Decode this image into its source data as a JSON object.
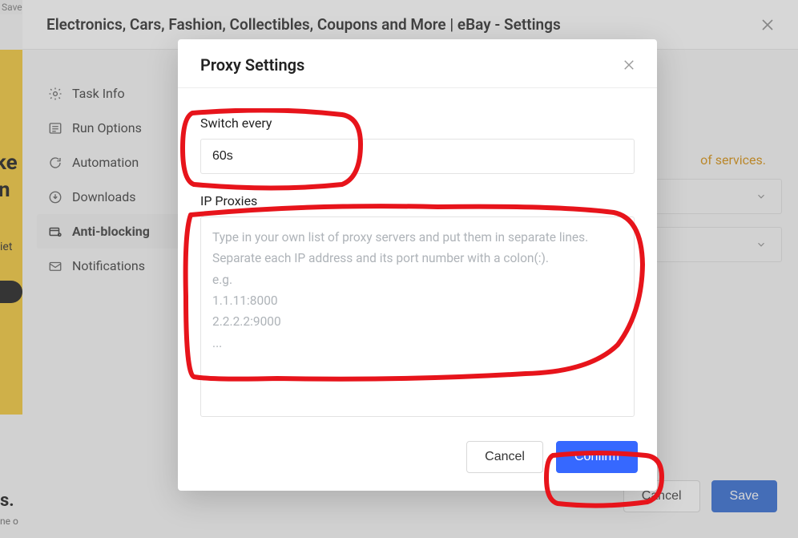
{
  "page": {
    "title": "Electronics, Cars, Fashion, Collectibles, Coupons and More | eBay - Settings",
    "save_hint": "Save"
  },
  "sidebar": {
    "items": [
      {
        "label": "Task Info"
      },
      {
        "label": "Run Options"
      },
      {
        "label": "Automation"
      },
      {
        "label": "Downloads"
      },
      {
        "label": "Anti-blocking"
      },
      {
        "label": "Notifications"
      }
    ]
  },
  "background": {
    "orange_text": "of services.",
    "bottom_heading": "s.",
    "bottom_sub": "ne o",
    "cancel_label": "Cancel",
    "save_label": "Save",
    "side_text_1": "ke",
    "side_text_2": "n",
    "side_text_3": "iet"
  },
  "modal": {
    "title": "Proxy Settings",
    "switch_label": "Switch every",
    "switch_value": "60s",
    "ip_proxies_label": "IP Proxies",
    "ip_proxies_placeholder": "Type in your own list of proxy servers and put them in separate lines.\nSeparate each IP address and its port number with a colon(:).\ne.g.\n1.1.11:8000\n2.2.2.2:9000\n...",
    "cancel_label": "Cancel",
    "confirm_label": "Confirm"
  }
}
